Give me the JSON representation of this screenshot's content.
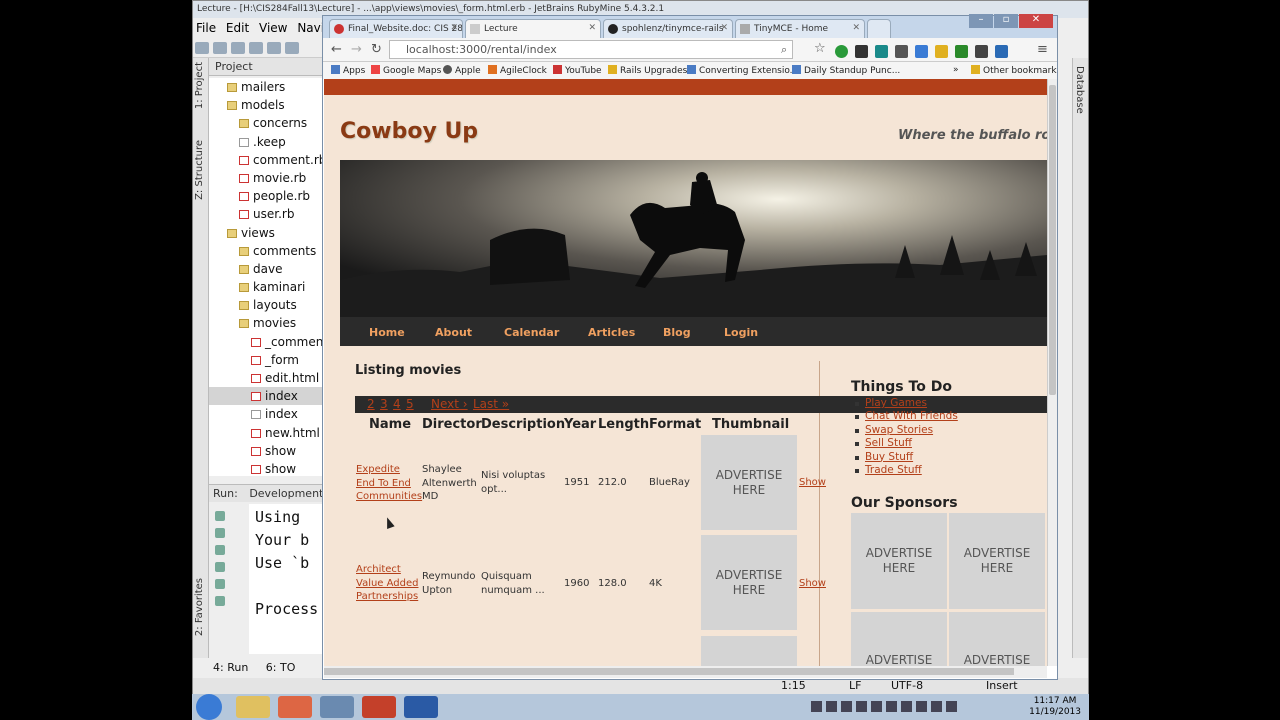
{
  "ide": {
    "title": "Lecture - [H:\\CIS284Fall13\\Lecture] - ...\\app\\views\\movies\\_form.html.erb - JetBrains RubyMine 5.4.3.2.1",
    "menu": [
      "File",
      "Edit",
      "View",
      "Navi"
    ],
    "project_tab": "Project",
    "side_tabs": [
      "1: Project",
      "Z: Structure",
      "2: Favorites"
    ],
    "tree": [
      {
        "indent": 2,
        "type": "folder",
        "label": "mailers"
      },
      {
        "indent": 2,
        "type": "folder",
        "label": "models"
      },
      {
        "indent": 3,
        "type": "folder",
        "label": "concerns"
      },
      {
        "indent": 3,
        "type": "file",
        "label": ".keep"
      },
      {
        "indent": 3,
        "type": "rb",
        "label": "comment.rb"
      },
      {
        "indent": 3,
        "type": "rb",
        "label": "movie.rb"
      },
      {
        "indent": 3,
        "type": "rb",
        "label": "people.rb"
      },
      {
        "indent": 3,
        "type": "rb",
        "label": "user.rb"
      },
      {
        "indent": 2,
        "type": "folder",
        "label": "views"
      },
      {
        "indent": 3,
        "type": "folder",
        "label": "comments"
      },
      {
        "indent": 3,
        "type": "folder",
        "label": "dave"
      },
      {
        "indent": 3,
        "type": "folder",
        "label": "kaminari"
      },
      {
        "indent": 3,
        "type": "folder",
        "label": "layouts"
      },
      {
        "indent": 3,
        "type": "folder",
        "label": "movies"
      },
      {
        "indent": 4,
        "type": "rb",
        "label": "_comment"
      },
      {
        "indent": 4,
        "type": "rb",
        "label": "_form"
      },
      {
        "indent": 4,
        "type": "rb",
        "label": "edit.html"
      },
      {
        "indent": 4,
        "type": "rb",
        "label": "index",
        "selected": true
      },
      {
        "indent": 4,
        "type": "file",
        "label": "index"
      },
      {
        "indent": 4,
        "type": "rb",
        "label": "new.html"
      },
      {
        "indent": 4,
        "type": "rb",
        "label": "show"
      },
      {
        "indent": 4,
        "type": "rb",
        "label": "show"
      }
    ],
    "run_label": "Run:",
    "run_tab": "Development",
    "console_lines": [
      "Using",
      "Your b",
      "Use `b",
      "",
      "Process"
    ],
    "bottom_tabs": [
      "4: Run",
      "6: TO"
    ],
    "status": {
      "position": "1:15",
      "line_sep": "LF",
      "encoding": "UTF-8",
      "mode": "Insert"
    },
    "right_tab": "Database"
  },
  "browser": {
    "tabs": [
      {
        "label": "Final_Website.doc: CIS 28",
        "favicon": "#c33",
        "active": false
      },
      {
        "label": "Lecture",
        "favicon": "#ccc",
        "active": true
      },
      {
        "label": "spohlenz/tinymce-rails",
        "favicon": "#222",
        "active": false
      },
      {
        "label": "TinyMCE - Home",
        "favicon": "#aaa",
        "active": false
      }
    ],
    "url": "localhost:3000/rental/index",
    "bookmarks": [
      "Apps",
      "Google Maps",
      "Apple",
      "AgileClock",
      "YouTube",
      "Rails Upgrades",
      "Converting Extensio...",
      "Daily Standup Punc...",
      "»",
      "Other bookmarks"
    ]
  },
  "site": {
    "title": "Cowboy Up",
    "tagline": "Where the buffalo ro",
    "nav": [
      "Home",
      "About",
      "Calendar",
      "Articles",
      "Blog",
      "Login"
    ],
    "listing_title": "Listing movies",
    "pager": {
      "pages": [
        "2",
        "3",
        "4",
        "5"
      ],
      "next": "Next ›",
      "last": "Last »"
    },
    "columns": [
      "Name",
      "Director",
      "Description",
      "Year",
      "Length",
      "Format",
      "Thumbnail"
    ],
    "movies": [
      {
        "name": "Expedite End To End Communities",
        "director": "Shaylee Altenwerth MD",
        "description": "Nisi voluptas opt...",
        "year": "1951",
        "length": "212.0",
        "format": "BlueRay",
        "thumb": "ADVERTISE HERE",
        "action": "Show"
      },
      {
        "name": "Architect Value Added Partnerships",
        "director": "Reymundo Upton",
        "description": "Quisquam numquam ...",
        "year": "1960",
        "length": "128.0",
        "format": "4K",
        "thumb": "ADVERTISE HERE",
        "action": "Show"
      }
    ],
    "sidebar": {
      "todo_title": "Things To Do",
      "todo_links": [
        "Play Games",
        "Chat With Friends",
        "Swap Stories",
        "Sell Stuff",
        "Buy Stuff",
        "Trade Stuff"
      ],
      "sponsors_title": "Our Sponsors",
      "sponsor_ads": [
        "ADVERTISE HERE",
        "ADVERTISE HERE",
        "ADVERTISE",
        "ADVERTISE"
      ]
    }
  },
  "clock": {
    "time": "11:17 AM",
    "date": "11/19/2013"
  },
  "colors": {
    "accent": "#b3401a",
    "page_bg": "#f5e5d6",
    "nav_bg": "#2b2b2b",
    "nav_text": "#f0a060"
  }
}
